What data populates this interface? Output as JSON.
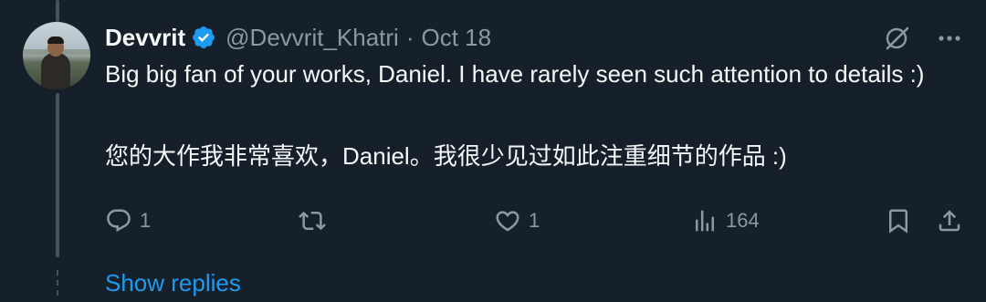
{
  "tweet": {
    "author": {
      "name": "Devvrit",
      "handle": "@Devvrit_Khatri",
      "separator": "·",
      "date": "Oct 18",
      "verified": true
    },
    "text_en": "Big big fan of your works, Daniel. I have rarely seen such attention to details :)",
    "text_zh": "您的大作我非常喜欢，Daniel。我很少见过如此注重细节的作品 :)",
    "actions": {
      "replies": "1",
      "retweets": "",
      "likes": "1",
      "views": "164"
    },
    "show_replies_label": "Show replies"
  },
  "icons": {
    "verified": "verified-badge-icon",
    "grok": "grok-icon",
    "more": "more-icon",
    "reply": "reply-icon",
    "retweet": "retweet-icon",
    "like": "like-icon",
    "views": "views-icon",
    "bookmark": "bookmark-icon",
    "share": "share-icon"
  },
  "colors": {
    "background": "#15202b",
    "text_primary": "#f7f9f9",
    "text_secondary": "#8b98a5",
    "accent": "#1d9bf0",
    "thread_line": "#425364"
  }
}
